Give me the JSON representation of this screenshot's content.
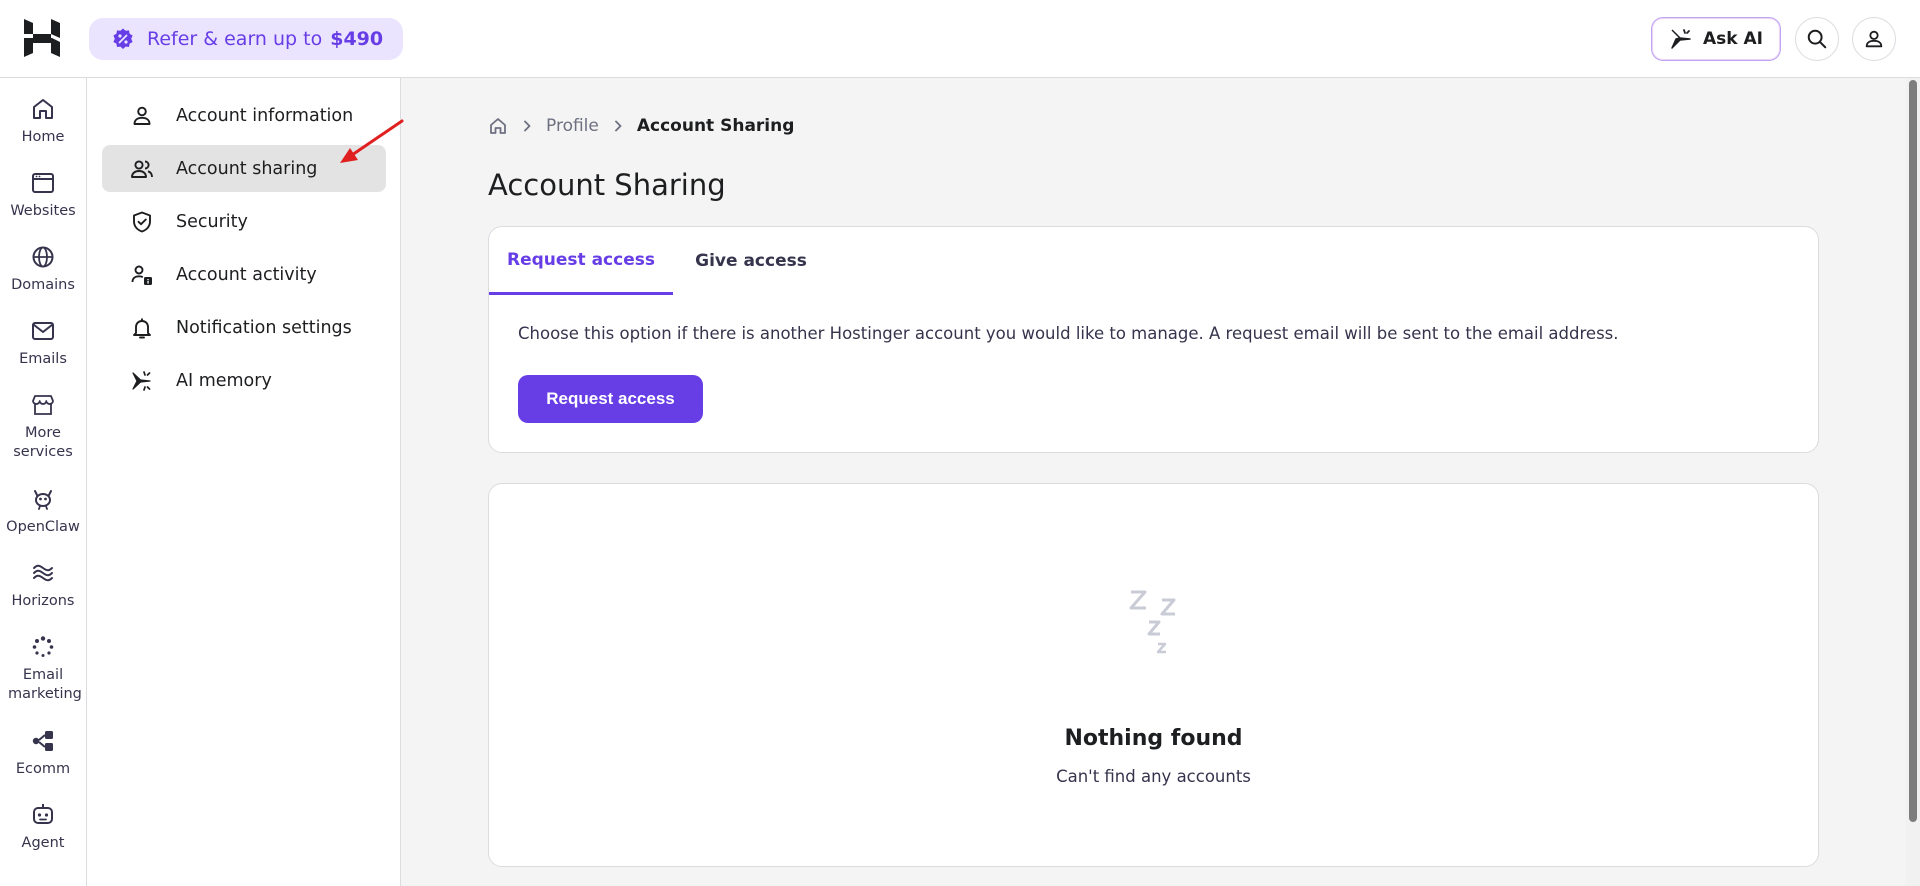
{
  "header": {
    "refer_text": "Refer & earn up to",
    "refer_amount": "$490",
    "ask_ai_label": "Ask AI",
    "icons": [
      "hostinger-logo",
      "refer-badge-icon",
      "ask-ai-sparkle-icon",
      "search-icon",
      "user-icon"
    ]
  },
  "rail": {
    "items": [
      {
        "label": "Home",
        "icon": "home-icon"
      },
      {
        "label": "Websites",
        "icon": "websites-icon"
      },
      {
        "label": "Domains",
        "icon": "globe-icon"
      },
      {
        "label": "Emails",
        "icon": "mail-icon"
      },
      {
        "label": "More services",
        "icon": "store-icon"
      },
      {
        "label": "OpenClaw",
        "icon": "openclaw-icon"
      },
      {
        "label": "Horizons",
        "icon": "horizons-icon"
      },
      {
        "label": "Email marketing",
        "icon": "email-marketing-icon"
      },
      {
        "label": "Ecomm",
        "icon": "ecomm-icon"
      },
      {
        "label": "Agent",
        "icon": "agent-icon"
      }
    ]
  },
  "subnav": {
    "items": [
      {
        "label": "Account information",
        "icon": "person-icon"
      },
      {
        "label": "Account sharing",
        "icon": "people-icon",
        "active": true
      },
      {
        "label": "Security",
        "icon": "shield-icon"
      },
      {
        "label": "Account activity",
        "icon": "account-activity-icon"
      },
      {
        "label": "Notification settings",
        "icon": "bell-icon"
      },
      {
        "label": "AI memory",
        "icon": "ai-sparkle-icon"
      }
    ]
  },
  "breadcrumb": {
    "items": [
      "Profile",
      "Account Sharing"
    ]
  },
  "main": {
    "title": "Account Sharing",
    "tabs": [
      {
        "label": "Request access",
        "active": true
      },
      {
        "label": "Give access",
        "active": false
      }
    ],
    "description": "Choose this option if there is another Hostinger account you would like to manage. A request email will be sent to the email address.",
    "request_button": "Request access",
    "empty_title": "Nothing found",
    "empty_subtitle": "Can't find any accounts"
  },
  "colors": {
    "accent": "#673de6",
    "accent_soft": "#ebe4ff",
    "annotation_arrow": "#e02020"
  }
}
